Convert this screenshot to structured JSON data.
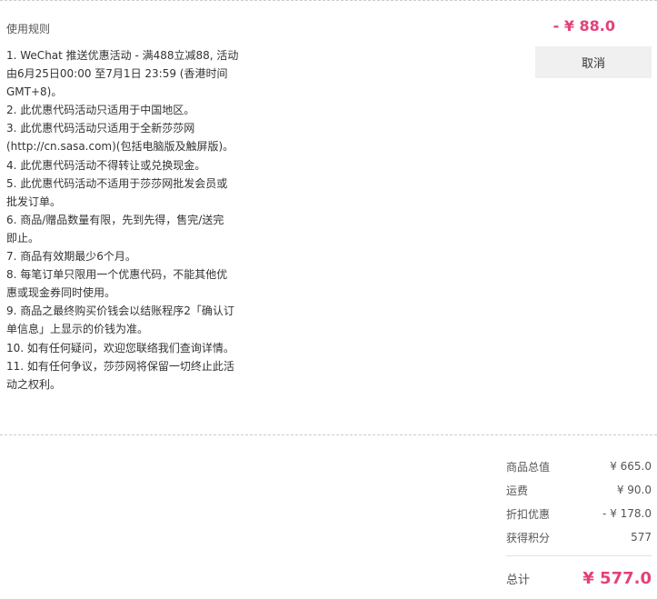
{
  "rules": {
    "title": "使用规则",
    "lines": [
      "1. WeChat 推送优惠活动 - 满488立减88, 活动",
      "由6月25日00:00 至7月1日 23:59 (香港时间",
      "GMT+8)。",
      "2. 此优惠代码活动只适用于中国地区。",
      "3. 此优惠代码活动只适用于全新莎莎网",
      "(http://cn.sasa.com)(包括电脑版及触屏版)。",
      "4. 此优惠代码活动不得转让或兑换现金。",
      "5. 此优惠代码活动不适用于莎莎网批发会员或",
      "批发订单。",
      "6. 商品/赠品数量有限，先到先得，售完/送完",
      "即止。",
      "7. 商品有效期最少6个月。",
      "8. 每笔订单只限用一个优惠代码，不能其他优",
      "惠或现金券同时使用。",
      "9. 商品之最终购买价钱会以结账程序2「确认订",
      "单信息」上显示的价钱为准。",
      "10. 如有任何疑问，欢迎您联络我们查询详情。",
      "11. 如有任何争议，莎莎网将保留一切终止此活",
      "动之权利。"
    ]
  },
  "coupon": {
    "discount": "- ¥ 88.0",
    "cancel_label": "取消"
  },
  "summary": {
    "rows": [
      {
        "label": "商品总值",
        "value": "¥ 665.0"
      },
      {
        "label": "运费",
        "value": "¥ 90.0"
      },
      {
        "label": "折扣优惠",
        "value": "- ¥ 178.0"
      },
      {
        "label": "获得积分",
        "value": "577"
      }
    ],
    "total_label": "总计",
    "total_value": "¥ 577.0"
  },
  "colors": {
    "accent": "#e4407b",
    "button_bg": "#f0f0f0"
  }
}
